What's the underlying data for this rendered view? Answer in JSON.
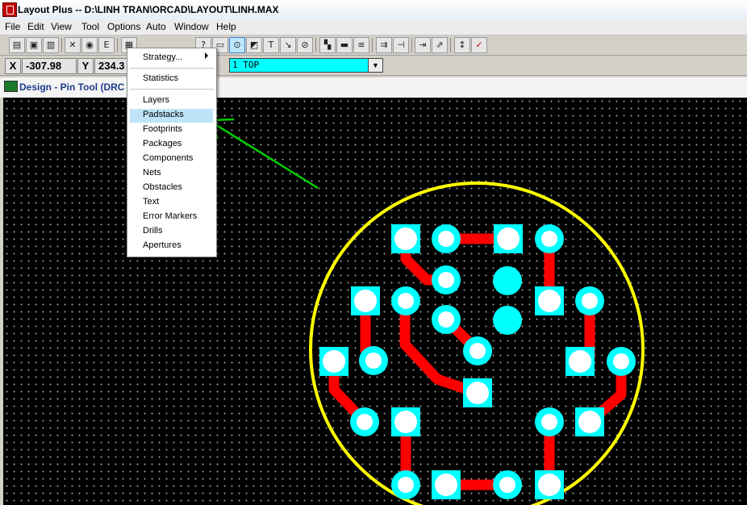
{
  "window": {
    "title": "Layout Plus -- D:\\LINH TRAN\\ORCAD\\LAYOUT\\LINH.MAX"
  },
  "menubar": [
    "File",
    "Edit",
    "View",
    "Tool",
    "Options",
    "Auto",
    "Window",
    "Help"
  ],
  "toolbar": {
    "icons": [
      "open-icon",
      "save-icon",
      "print-icon",
      "clear-icon",
      "binoculars-icon",
      "edit-icon",
      "spreadsheet-icon",
      "zoom-in-icon",
      "zoom-out-icon",
      "zoom-all-icon",
      "query-icon",
      "component-icon",
      "pin-tool-icon",
      "obstacle-icon",
      "text-icon",
      "connection-icon",
      "error-icon",
      "color-icon",
      "drc-box-icon",
      "reconnect-icon",
      "auto-route-icon",
      "route-icon",
      "refresh-icon",
      "shove-icon",
      "online-drc-icon",
      "drc-check-icon"
    ]
  },
  "coords": {
    "x_label": "X",
    "x_value": "-307.98",
    "y_label": "Y",
    "y_value": "234.3",
    "layer": "1  TOP"
  },
  "document": {
    "title": "Design - Pin Tool (DRC O"
  },
  "dropdown": {
    "items": [
      "Strategy...",
      "Statistics",
      "Layers",
      "Padstacks",
      "Footprints",
      "Packages",
      "Components",
      "Nets",
      "Obstacles",
      "Text",
      "Error Markers",
      "Drills",
      "Apertures"
    ],
    "highlighted": "Padstacks"
  },
  "colors": {
    "board": "#000000",
    "outline": "#ffff00",
    "trace": "#ff0000",
    "pad": "#00ffff",
    "pad_center": "#ffffff",
    "annotation": "#00cc00",
    "layer_bg": "#00ffff"
  }
}
